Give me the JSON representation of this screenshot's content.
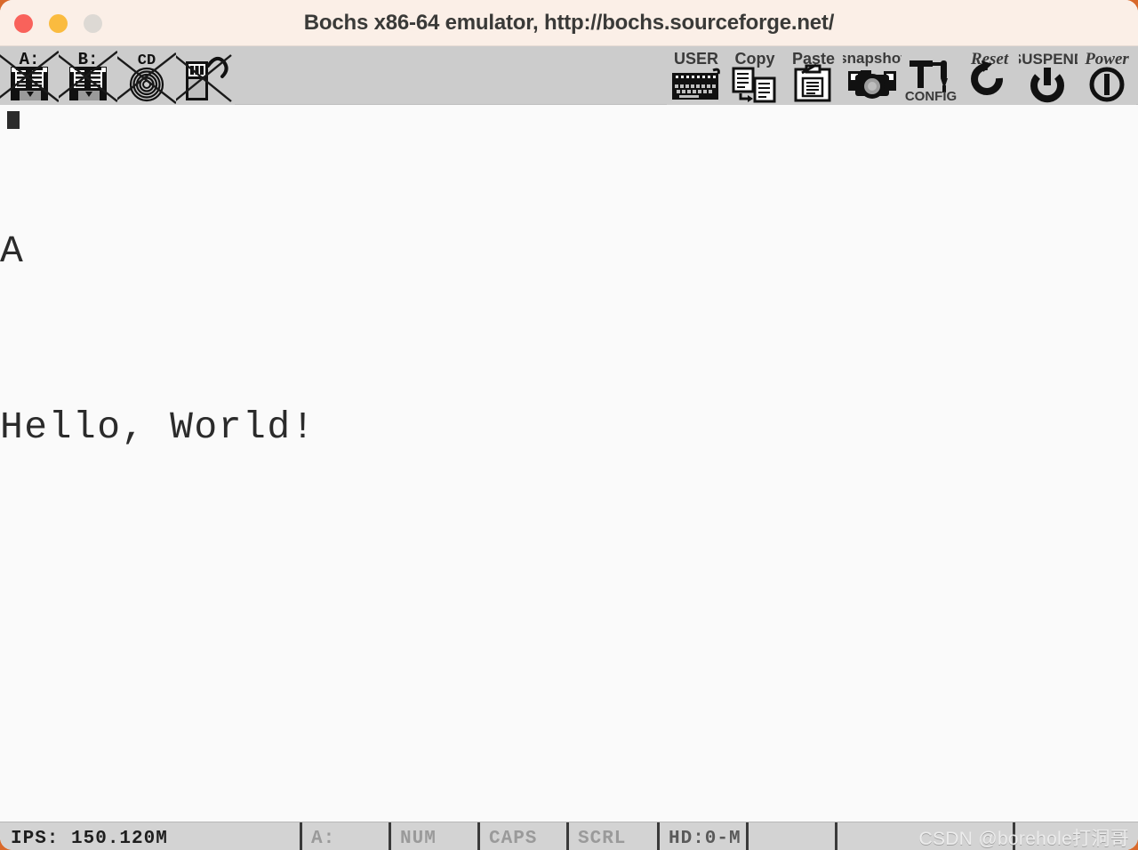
{
  "window": {
    "title": "Bochs x86-64 emulator, http://bochs.sourceforge.net/",
    "desktop_background_color": "#D9692B",
    "titlebar_color": "#FBEFE7",
    "traffic_lights": [
      {
        "name": "close",
        "label": "Close",
        "color": "#F9625B"
      },
      {
        "name": "minimize",
        "label": "Minimize",
        "color": "#FABB3F"
      },
      {
        "name": "zoom",
        "label": "Zoom",
        "color": "#DDD9D4"
      }
    ]
  },
  "toolbar": {
    "background_color": "#CCCCCC",
    "left_buttons": [
      {
        "icon": "floppy-a-icon",
        "label": "A:",
        "disabled": true
      },
      {
        "icon": "floppy-b-icon",
        "label": "B:",
        "disabled": true
      },
      {
        "icon": "cdrom-icon",
        "label": "CD",
        "disabled": true
      },
      {
        "icon": "usb-icon",
        "label": "",
        "disabled": true
      }
    ],
    "right_buttons": [
      {
        "icon": "keyboard-icon",
        "label": "USER"
      },
      {
        "icon": "copy-icon",
        "label": "Copy"
      },
      {
        "icon": "paste-icon",
        "label": "Paste"
      },
      {
        "icon": "snapshot-icon",
        "label": "snapshot"
      },
      {
        "icon": "config-icon",
        "label": "CONFIG"
      },
      {
        "icon": "reset-icon",
        "label": "Reset"
      },
      {
        "icon": "suspend-icon",
        "label": "SUSPEND"
      },
      {
        "icon": "power-icon",
        "label": "Power"
      }
    ]
  },
  "screen": {
    "background_color": "#FAFAFA",
    "text_color": "#2B2B2B",
    "lines": [
      "A",
      "Hello, World!"
    ]
  },
  "statusbar": {
    "background_color": "#D3D3D3",
    "ips": "IPS: 150.120M",
    "drive": "A:",
    "num": "NUM",
    "caps": "CAPS",
    "scrl": "SCRL",
    "hd": "HD:0-M",
    "spare1": "",
    "spare2": "",
    "spare3": "",
    "watermark": "CSDN @borehole打洞哥"
  }
}
